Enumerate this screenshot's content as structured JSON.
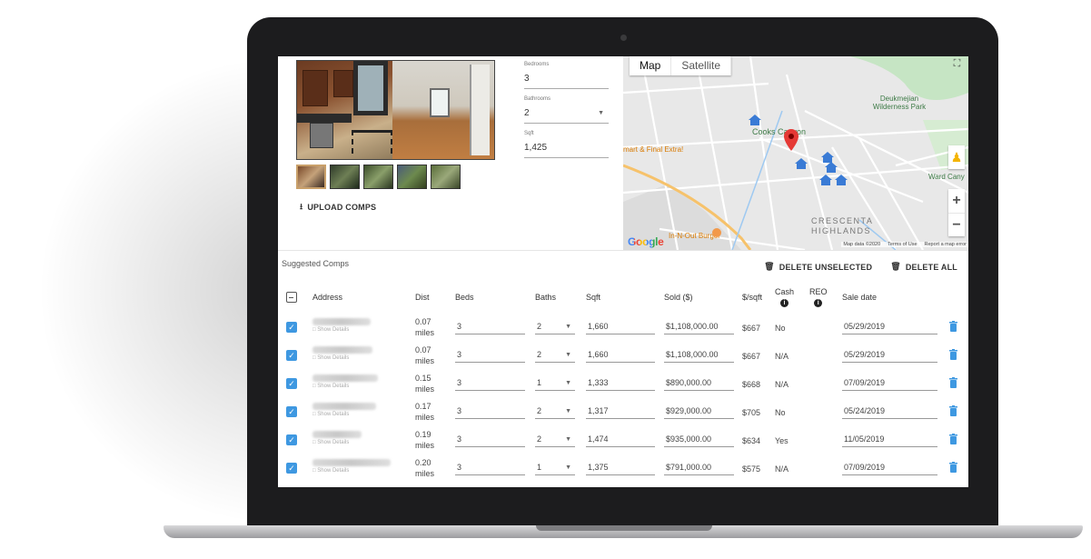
{
  "property": {
    "bedrooms_label": "Bedrooms",
    "bedrooms_value": "3",
    "bathrooms_label": "Bathrooms",
    "bathrooms_value": "2",
    "sqft_label": "Sqft",
    "sqft_value": "1,425",
    "upload_label": "UPLOAD COMPS"
  },
  "map": {
    "tab_map": "Map",
    "tab_satellite": "Satellite",
    "labels": [
      "Deukmejian Wilderness Park",
      "Cooks Canyon",
      "mart & Final Extra!",
      "CRESCENTA",
      "HIGHLANDS",
      "In-N-Out Burger",
      "Ward Cany"
    ],
    "footer": [
      "Map data ©2020",
      "Terms of Use",
      "Report a map error"
    ],
    "google": "Google"
  },
  "comps": {
    "title": "Suggested Comps",
    "delete_unselected": "DELETE UNSELECTED",
    "delete_all": "DELETE ALL",
    "show_details": "Show Details",
    "headers": {
      "address": "Address",
      "dist": "Dist",
      "beds": "Beds",
      "baths": "Baths",
      "sqft": "Sqft",
      "sold": "Sold ($)",
      "ppsf": "$/sqft",
      "cash": "Cash",
      "reo": "REO",
      "sale_date": "Sale date"
    },
    "rows": [
      {
        "dist": "0.07",
        "unit": "miles",
        "beds": "3",
        "baths": "2",
        "sqft": "1,660",
        "sold": "$1,108,000.00",
        "ppsf": "$667",
        "cash": "No",
        "date": "05/29/2019"
      },
      {
        "dist": "0.07",
        "unit": "miles",
        "beds": "3",
        "baths": "2",
        "sqft": "1,660",
        "sold": "$1,108,000.00",
        "ppsf": "$667",
        "cash": "N/A",
        "date": "05/29/2019"
      },
      {
        "dist": "0.15",
        "unit": "miles",
        "beds": "3",
        "baths": "1",
        "sqft": "1,333",
        "sold": "$890,000.00",
        "ppsf": "$668",
        "cash": "N/A",
        "date": "07/09/2019"
      },
      {
        "dist": "0.17",
        "unit": "miles",
        "beds": "3",
        "baths": "2",
        "sqft": "1,317",
        "sold": "$929,000.00",
        "ppsf": "$705",
        "cash": "No",
        "date": "05/24/2019"
      },
      {
        "dist": "0.19",
        "unit": "miles",
        "beds": "3",
        "baths": "2",
        "sqft": "1,474",
        "sold": "$935,000.00",
        "ppsf": "$634",
        "cash": "Yes",
        "date": "11/05/2019"
      },
      {
        "dist": "0.20",
        "unit": "miles",
        "beds": "3",
        "baths": "1",
        "sqft": "1,375",
        "sold": "$791,000.00",
        "ppsf": "$575",
        "cash": "N/A",
        "date": "07/09/2019"
      }
    ]
  },
  "colors": {
    "accent": "#3e98e1",
    "map_pin": "#e53935"
  }
}
